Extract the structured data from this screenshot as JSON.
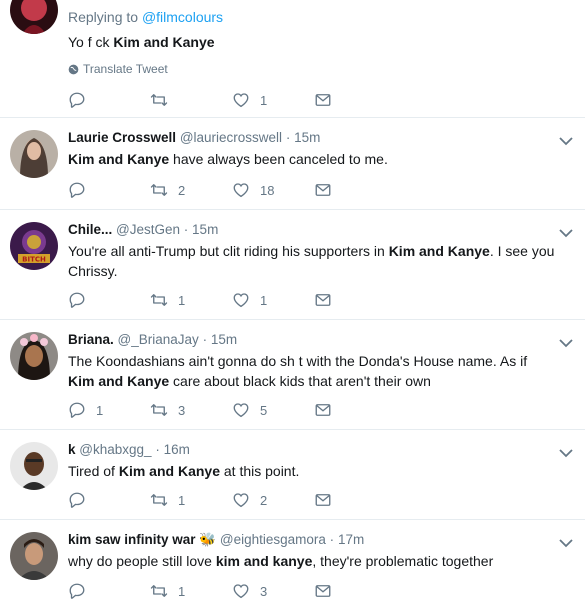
{
  "tweets": [
    {
      "replying_prefix": "Replying to ",
      "replying_to": "@filmcolours",
      "text_before": "Yo f  ck ",
      "text_bold": "Kim and Kanye",
      "text_after": "",
      "translate_label": "Translate Tweet",
      "reply_count": "",
      "retweet_count": "",
      "like_count": "1"
    },
    {
      "name": "Laurie Crosswell",
      "handle": "@lauriecrosswell",
      "dot": "·",
      "time": "15m",
      "text_bold": "Kim and Kanye",
      "text_after": " have always been canceled to me.",
      "reply_count": "",
      "retweet_count": "2",
      "like_count": "18"
    },
    {
      "name": "Chile...",
      "handle": "@JestGen",
      "dot": "·",
      "time": "15m",
      "text_before": "You're all anti-Trump but clit riding his supporters in ",
      "text_bold": "Kim and Kanye",
      "text_after": ". I see you Chrissy.",
      "reply_count": "",
      "retweet_count": "1",
      "like_count": "1"
    },
    {
      "name": "Briana.",
      "handle": "@_BrianaJay",
      "dot": "·",
      "time": "15m",
      "text_before": "The Koondashians ain't gonna do sh  t with the Donda's House name. As if ",
      "text_bold": "Kim and Kanye",
      "text_after": " care about black kids that aren't their own",
      "reply_count": "1",
      "retweet_count": "3",
      "like_count": "5"
    },
    {
      "name": "k",
      "handle": "@khabxgg_",
      "dot": "·",
      "time": "16m",
      "text_before": "Tired of ",
      "text_bold": "Kim and Kanye",
      "text_after": " at this point.",
      "reply_count": "",
      "retweet_count": "1",
      "like_count": "2"
    },
    {
      "name": "kim saw infinity war",
      "emoji": "🐝",
      "handle": "@eightiesgamora",
      "dot": "·",
      "time": "17m",
      "text_before": "why do people still love ",
      "text_bold": "kim and kanye",
      "text_after": ", they're problematic together",
      "reply_count": "",
      "retweet_count": "1",
      "like_count": "3"
    }
  ],
  "colors": {
    "link": "#1da1f2",
    "secondary": "#657786",
    "border": "#e6ecf0"
  },
  "icons": [
    "reply-icon",
    "retweet-icon",
    "like-icon",
    "message-icon",
    "globe-icon",
    "chevron-down-icon"
  ]
}
